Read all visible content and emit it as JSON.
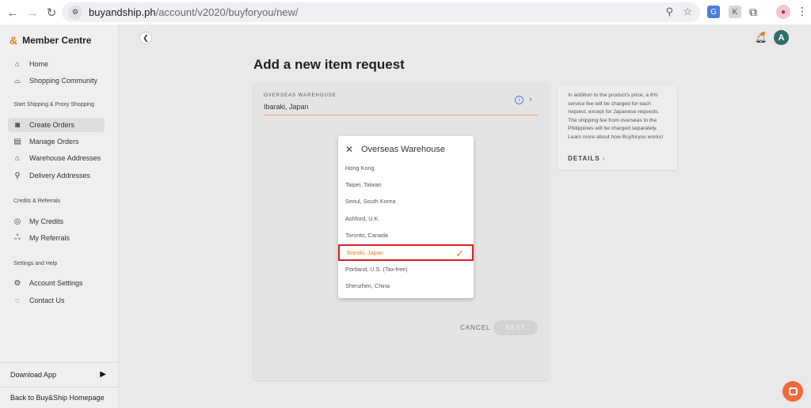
{
  "browser": {
    "url_host": "buyandship.ph",
    "url_path": "/account/v2020/buyforyou/new/",
    "profile_letter": "A"
  },
  "sidebar": {
    "brand": "Member Centre",
    "items_top": [
      {
        "label": "Home",
        "icon": "home-icon"
      },
      {
        "label": "Shopping Community",
        "icon": "community-icon"
      }
    ],
    "section_shipping": "Start Shipping & Proxy Shopping",
    "items_shipping": [
      {
        "label": "Create Orders",
        "icon": "create-orders-icon",
        "active": true
      },
      {
        "label": "Manage Orders",
        "icon": "manage-orders-icon"
      },
      {
        "label": "Warehouse Addresses",
        "icon": "warehouse-icon"
      },
      {
        "label": "Delivery Addresses",
        "icon": "delivery-icon"
      }
    ],
    "section_credits": "Credits & Referrals",
    "items_credits": [
      {
        "label": "My Credits",
        "icon": "credits-icon"
      },
      {
        "label": "My Referrals",
        "icon": "referrals-icon"
      }
    ],
    "section_settings": "Settings and Help",
    "items_settings": [
      {
        "label": "Account Settings",
        "icon": "settings-icon"
      },
      {
        "label": "Contact Us",
        "icon": "contact-icon"
      }
    ],
    "download_app": "Download App",
    "back_home": "Back to Buy&Ship Homepage"
  },
  "main": {
    "title": "Add a new item request",
    "warehouse_label": "OVERSEAS WAREHOUSE",
    "warehouse_value": "Ibaraki, Japan",
    "cancel": "CANCEL",
    "next": "NEXT"
  },
  "info_card": {
    "text": "In addition to the product's price, a 6% service fee will be charged for each request, except for Japanese requests. The shipping fee from overseas to the Philippines will be charged separately. Learn more about how Buyforyou works!",
    "details": "DETAILS"
  },
  "dropdown": {
    "title": "Overseas Warehouse",
    "options": [
      "Hong Kong",
      "Taipei, Taiwan",
      "Seoul, South Korea",
      "Ashford, U.K.",
      "Toronto, Canada",
      "Ibaraki, Japan",
      "Portland, U.S. (Tax-free)",
      "Shenzhen, China"
    ],
    "selected": "Ibaraki, Japan"
  },
  "colors": {
    "accent": "#f07c1e",
    "highlight_border": "#e0201f",
    "avatar": "#2f6e6a"
  }
}
